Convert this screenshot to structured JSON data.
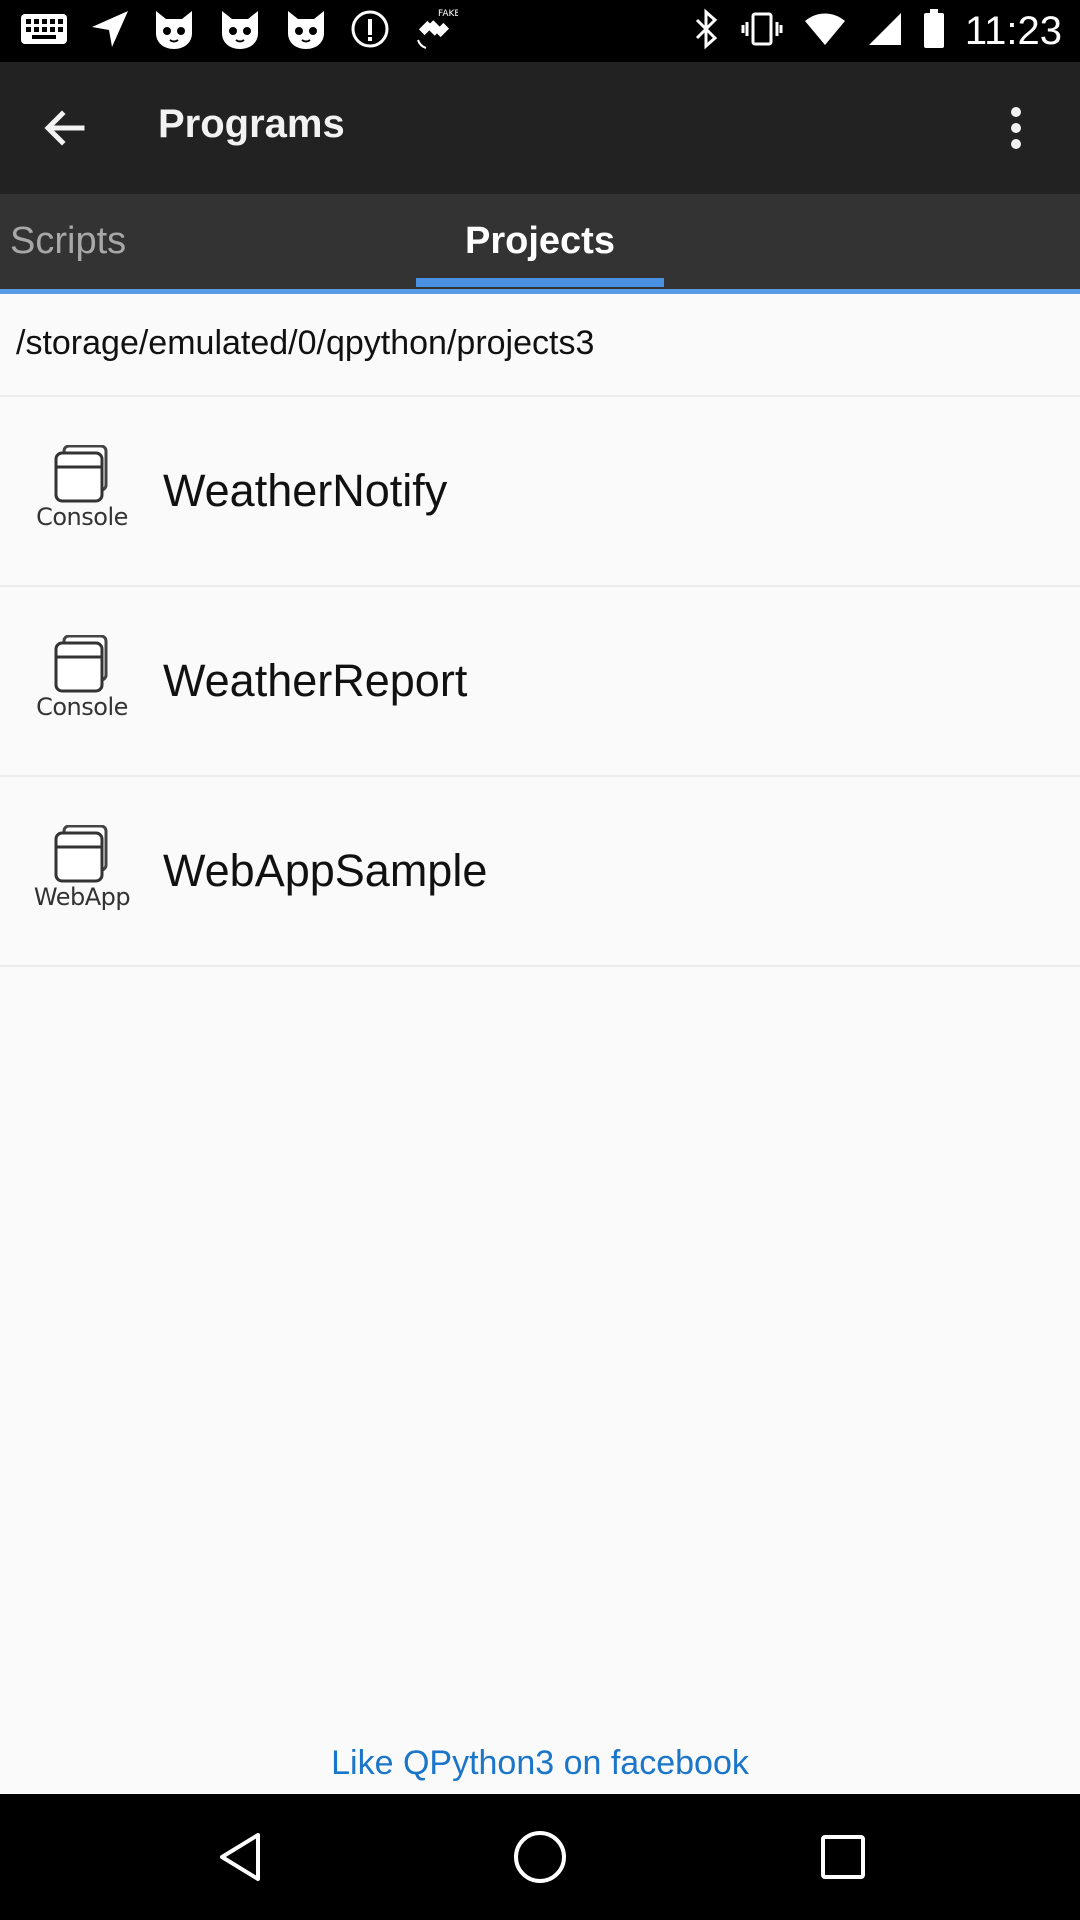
{
  "status_bar": {
    "time": "11:23",
    "left_icons": [
      "keyboard-icon",
      "navigation-icon",
      "cat-face-icon",
      "cat-face-icon",
      "cat-face-icon",
      "info-icon",
      "satellite-icon"
    ],
    "right_icons": [
      "bluetooth-icon",
      "vibrate-icon",
      "wifi-icon",
      "signal-icon",
      "battery-icon"
    ]
  },
  "app_bar": {
    "title": "Programs",
    "back_icon": "arrow-back-icon",
    "more_icon": "more-vert-icon"
  },
  "tabs": [
    {
      "label": "Scripts",
      "selected": false
    },
    {
      "label": "Projects",
      "selected": true
    }
  ],
  "path": "/storage/emulated/0/qpython/projects3",
  "projects": [
    {
      "name": "WeatherNotify",
      "type": "Console",
      "icon": "console-icon"
    },
    {
      "name": "WeatherReport",
      "type": "Console",
      "icon": "console-icon"
    },
    {
      "name": "WebAppSample",
      "type": "WebApp",
      "icon": "webapp-icon"
    }
  ],
  "footer": {
    "link": "Like QPython3 on facebook"
  },
  "nav_bar": {
    "icons": [
      "nav-back-icon",
      "nav-home-icon",
      "nav-recents-icon"
    ]
  },
  "colors": {
    "app_bar": "#222222",
    "tab_bar": "#333333",
    "accent": "#4a90e2",
    "link": "#1b75c9",
    "background": "#fafafa"
  }
}
